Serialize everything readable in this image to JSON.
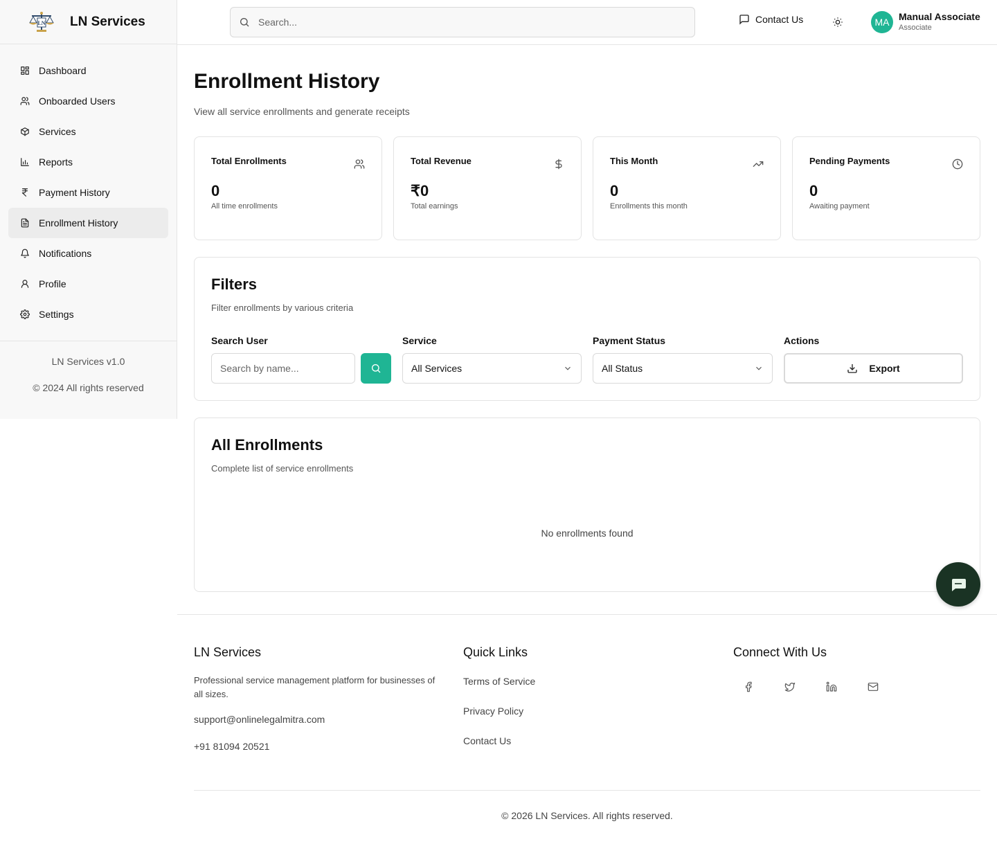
{
  "brand": {
    "name": "LN Services"
  },
  "sidebar": {
    "items": [
      {
        "label": "Dashboard",
        "icon": "dashboard-icon"
      },
      {
        "label": "Onboarded Users",
        "icon": "users-icon"
      },
      {
        "label": "Services",
        "icon": "package-icon"
      },
      {
        "label": "Reports",
        "icon": "bar-chart-icon"
      },
      {
        "label": "Payment History",
        "icon": "rupee-icon"
      },
      {
        "label": "Enrollment History",
        "icon": "file-text-icon",
        "active": true
      },
      {
        "label": "Notifications",
        "icon": "bell-icon"
      },
      {
        "label": "Profile",
        "icon": "user-icon"
      },
      {
        "label": "Settings",
        "icon": "gear-icon"
      }
    ],
    "version": "LN Services v1.0",
    "copyright": "© 2024 All rights reserved"
  },
  "header": {
    "search_placeholder": "Search...",
    "contact_label": "Contact Us",
    "user": {
      "initials": "MA",
      "name": "Manual Associate",
      "role": "Associate"
    }
  },
  "page": {
    "title": "Enrollment History",
    "subtitle": "View all service enrollments and generate receipts"
  },
  "stats": [
    {
      "label": "Total Enrollments",
      "value": "0",
      "sub": "All time enrollments",
      "icon": "users-icon"
    },
    {
      "label": "Total Revenue",
      "value": "₹0",
      "sub": "Total earnings",
      "icon": "dollar-icon"
    },
    {
      "label": "This Month",
      "value": "0",
      "sub": "Enrollments this month",
      "icon": "trending-up-icon"
    },
    {
      "label": "Pending Payments",
      "value": "0",
      "sub": "Awaiting payment",
      "icon": "clock-icon"
    }
  ],
  "filters": {
    "title": "Filters",
    "subtitle": "Filter enrollments by various criteria",
    "search_label": "Search User",
    "search_placeholder": "Search by name...",
    "service_label": "Service",
    "service_value": "All Services",
    "status_label": "Payment Status",
    "status_value": "All Status",
    "actions_label": "Actions",
    "export_label": "Export"
  },
  "enrollments": {
    "title": "All Enrollments",
    "subtitle": "Complete list of service enrollments",
    "empty": "No enrollments found"
  },
  "footer": {
    "brand": "LN Services",
    "description": "Professional service management platform for businesses of all sizes.",
    "email": "support@onlinelegalmitra.com",
    "phone": "+91 81094 20521",
    "quick_links_title": "Quick Links",
    "links": [
      "Terms of Service",
      "Privacy Policy",
      "Contact Us"
    ],
    "connect_title": "Connect With Us",
    "copyright": "© 2026 LN Services. All rights reserved."
  },
  "colors": {
    "accent": "#1fb594",
    "chat_button": "#1a3324"
  }
}
